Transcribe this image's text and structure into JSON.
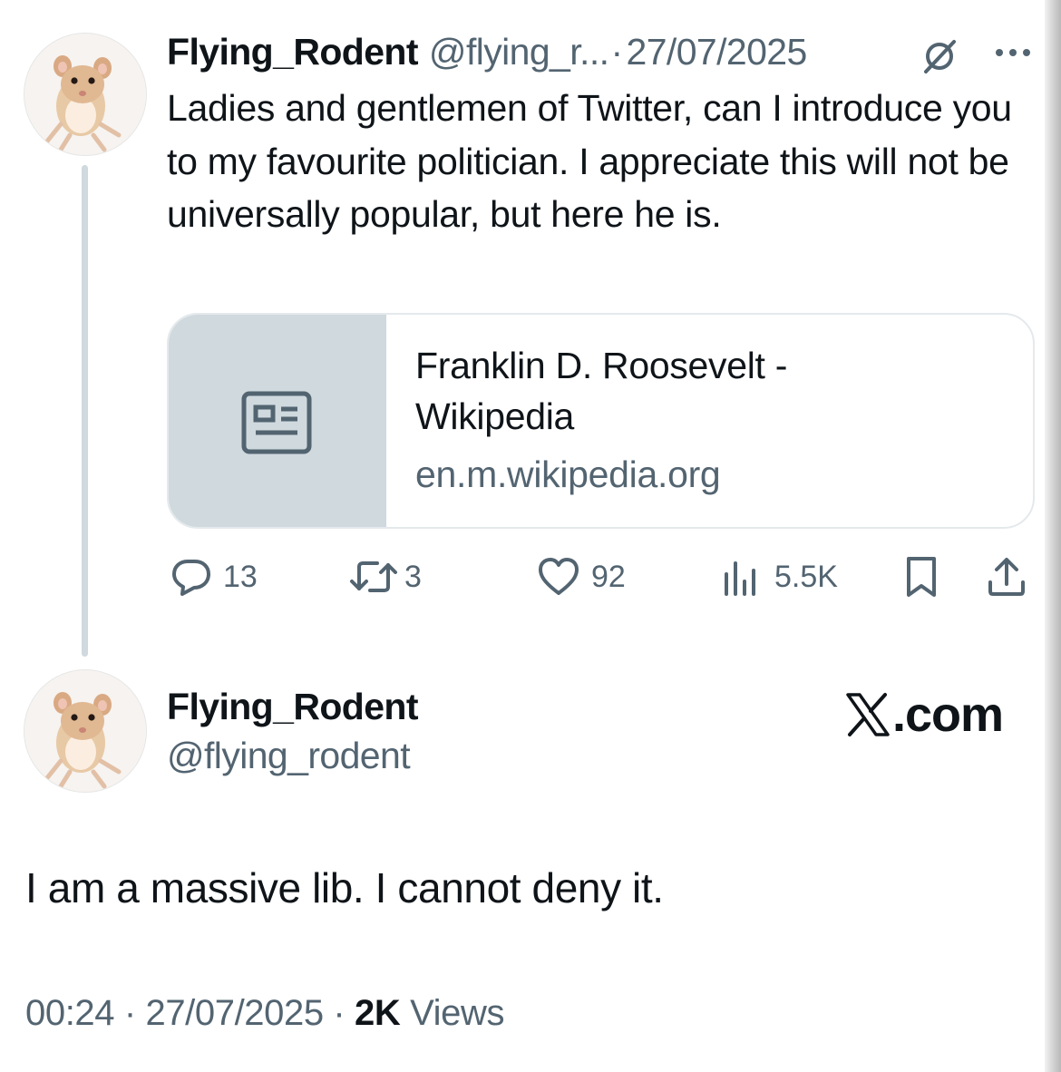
{
  "first_tweet": {
    "display_name": "Flying_Rodent",
    "handle": "@flying_r...",
    "separator": "·",
    "date": "27/07/2025",
    "text": "Ladies and gentlemen of Twitter, can I introduce you to my favourite politician. I appreciate this will not be universally popular, but here he is.",
    "link_card": {
      "title": "Franklin D. Roosevelt - Wikipedia",
      "domain": "en.m.wikipedia.org",
      "thumb_icon": "news-article-icon"
    },
    "actions": {
      "replies": "13",
      "reposts": "3",
      "likes": "92",
      "views": "5.5K"
    },
    "icons": {
      "grok": "grok-icon",
      "more": "more-icon",
      "reply": "reply-icon",
      "repost": "repost-icon",
      "like": "heart-icon",
      "views": "views-icon",
      "bookmark": "bookmark-icon",
      "share": "share-icon"
    }
  },
  "second_tweet": {
    "display_name": "Flying_Rodent",
    "handle": "@flying_rodent",
    "brand": ".com",
    "text": "I am a massive lib. I cannot deny it.",
    "time": "00:24",
    "separator": "·",
    "date": "27/07/2025",
    "views_count": "2K",
    "views_label": "Views"
  },
  "colors": {
    "text_primary": "#0f1419",
    "text_secondary": "#536471",
    "thread_line": "#cfd9de",
    "card_thumb_bg": "#cfd9de",
    "card_border": "#e4e9ec"
  }
}
